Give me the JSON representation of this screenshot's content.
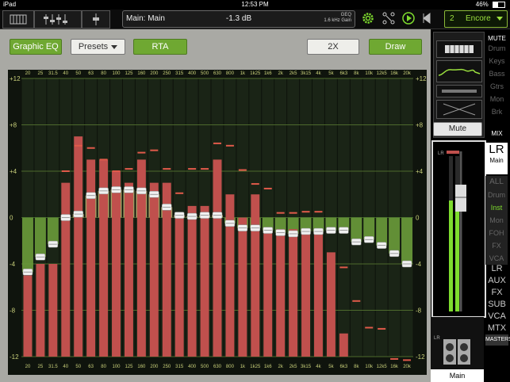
{
  "status": {
    "device": "iPad",
    "time": "12:53 PM",
    "battery": "46%"
  },
  "topbar": {
    "channel_name": "Main: Main",
    "gain_value": "-1.3 dB",
    "geq_label": "GEQ",
    "gain_detail": "1.6 kHz Gain",
    "scene_number": "2",
    "scene_name": "Encore"
  },
  "toolbar": {
    "graphic_eq": "Graphic EQ",
    "presets": "Presets",
    "rta": "RTA",
    "zoom": "2X",
    "draw": "Draw"
  },
  "eq": {
    "y_ticks": [
      "+12",
      "+8",
      "+4",
      "0",
      "-4",
      "-8",
      "-12"
    ],
    "bands": [
      "20",
      "25",
      "31.5",
      "40",
      "50",
      "63",
      "80",
      "100",
      "125",
      "160",
      "200",
      "250",
      "315",
      "400",
      "500",
      "630",
      "800",
      "1k",
      "1k25",
      "1k6",
      "2k",
      "2k5",
      "3k15",
      "4k",
      "5k",
      "6k3",
      "8k",
      "10k",
      "12k5",
      "16k",
      "20k"
    ],
    "gains": [
      -4.7,
      -3.4,
      -2.3,
      0.0,
      0.3,
      1.9,
      2.3,
      2.4,
      2.4,
      2.3,
      2.0,
      0.9,
      0.2,
      0.1,
      0.2,
      0.2,
      -0.5,
      -0.9,
      -0.9,
      -1.1,
      -1.3,
      -1.4,
      -1.2,
      -1.2,
      -1.1,
      -1.1,
      -2.1,
      -1.9,
      -2.4,
      -3.1,
      -4.0
    ],
    "rta_levels": [
      -5,
      -4,
      -4,
      3,
      7,
      5,
      5,
      4,
      3,
      5,
      3,
      3,
      0,
      1,
      1,
      5,
      2,
      0,
      2,
      -1,
      -1,
      -1,
      -1,
      -1,
      -3,
      -10,
      -12,
      -12,
      -12,
      -12,
      -12
    ],
    "rta_peaks": [
      null,
      null,
      null,
      4,
      6.2,
      6,
      5,
      4,
      4.2,
      5.6,
      5.8,
      4.2,
      2.1,
      4.2,
      4.2,
      6.4,
      6.2,
      4.1,
      2.9,
      2.5,
      0.4,
      0.4,
      0.5,
      0.5,
      -1.3,
      -4.3,
      -7.2,
      -9.5,
      -9.6,
      -12.2,
      -12.3
    ]
  },
  "strip": {
    "mute_label": "Mute",
    "fader_channel": "LR",
    "fader_scale": [
      "10",
      "5",
      "0",
      "5",
      "10",
      "15",
      "20",
      "30",
      "40",
      "50",
      "∞"
    ],
    "meter_scale": [
      "10",
      "5",
      "0",
      "1",
      "2",
      "3",
      "4",
      "5",
      "6",
      "7",
      "8",
      "9",
      "10"
    ]
  },
  "sidebar": {
    "mute_header": "MUTE",
    "mute_groups": [
      "Drum",
      "Keys",
      "Bass",
      "Gtrs",
      "Mon",
      "Brk"
    ],
    "mix_header": "MIX",
    "lr_main_big": "LR",
    "lr_main_sub": "Main",
    "mix_groups": [
      "ALL",
      "Drum",
      "Inst",
      "Mon",
      "FOH",
      "FX",
      "VCA"
    ],
    "mix_active": "Inst",
    "nav": [
      "LR",
      "AUX",
      "FX",
      "SUB",
      "VCA",
      "MTX"
    ],
    "masters_label": "MASTERS",
    "bottom_channel": "LR",
    "bottom_name": "Main"
  },
  "colors": {
    "accent_green": "#7edb2e",
    "rta_red": "#c0504d",
    "eq_green": "#6a9b3a",
    "eq_tan": "#b3a96a"
  }
}
